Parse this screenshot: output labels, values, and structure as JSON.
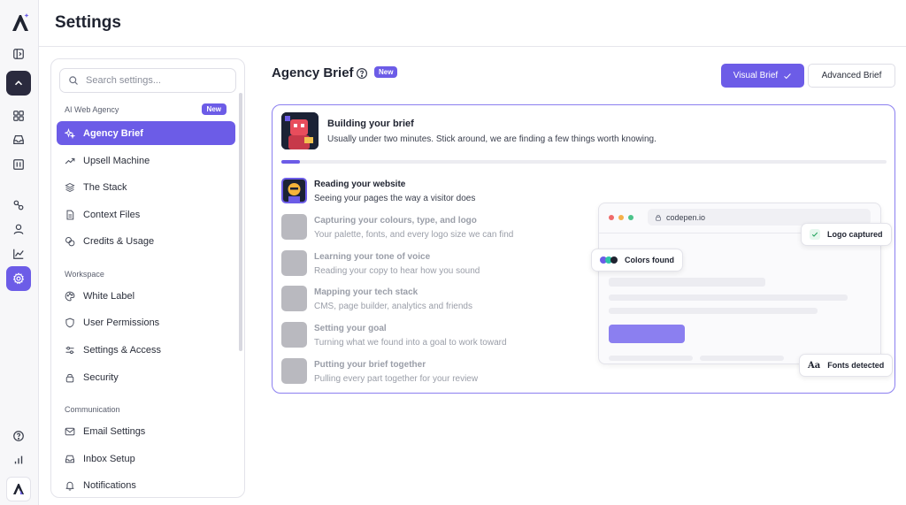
{
  "app": {
    "title": "Settings"
  },
  "rail": {
    "icons": [
      "app-logo",
      "sidebar-toggle-icon",
      "chevron-up-icon",
      "grid-icon",
      "inbox-icon",
      "calendar-icon",
      "integrations-icon",
      "user-icon",
      "chart-icon",
      "gear-icon",
      "help-icon",
      "bar-chart-icon",
      "brand-logo"
    ]
  },
  "nav": {
    "search_placeholder": "Search settings...",
    "sections": [
      {
        "label": "AI Web Agency",
        "badge": "New"
      },
      {
        "label": "Workspace"
      },
      {
        "label": "Communication"
      }
    ],
    "items": [
      {
        "label": "Agency Brief",
        "icon": "sparkle-icon",
        "active": true
      },
      {
        "label": "Upsell Machine",
        "icon": "trend-up-icon"
      },
      {
        "label": "The Stack",
        "icon": "layers-icon"
      },
      {
        "label": "Context Files",
        "icon": "file-icon"
      },
      {
        "label": "Credits & Usage",
        "icon": "coins-icon"
      },
      {
        "label": "White Label",
        "icon": "palette-icon"
      },
      {
        "label": "User Permissions",
        "icon": "shield-icon"
      },
      {
        "label": "Settings & Access",
        "icon": "sliders-icon"
      },
      {
        "label": "Security",
        "icon": "lock-icon"
      },
      {
        "label": "Email Settings",
        "icon": "mail-icon"
      },
      {
        "label": "Inbox Setup",
        "icon": "inbox-icon"
      },
      {
        "label": "Notifications",
        "icon": "bell-icon"
      }
    ]
  },
  "content": {
    "title": "Agency Brief",
    "badge": "New",
    "visual_brief_label": "Visual Brief",
    "advanced_brief_label": "Advanced Brief"
  },
  "brief": {
    "title": "Building your brief",
    "subtitle": "Usually under two minutes. Stick around, we are finding a few things worth knowing.",
    "progress": 0.03,
    "steps": [
      {
        "title": "Reading your website",
        "subtitle": "Seeing your pages the way a visitor does",
        "current": true
      },
      {
        "title": "Capturing your colours, type, and logo",
        "subtitle": "Your palette, fonts, and every logo size we can find"
      },
      {
        "title": "Learning your tone of voice",
        "subtitle": "Reading your copy to hear how you sound"
      },
      {
        "title": "Mapping your tech stack",
        "subtitle": "CMS, page builder, analytics and friends"
      },
      {
        "title": "Setting your goal",
        "subtitle": "Turning what we found into a goal to work toward"
      },
      {
        "title": "Putting your brief together",
        "subtitle": "Pulling every part together for your review"
      }
    ]
  },
  "preview": {
    "url": "codepen.io",
    "chips": {
      "colors": "Colors found",
      "logo": "Logo captured",
      "fonts_icon": "Aa",
      "fonts": "Fonts detected"
    },
    "swatches": [
      "#6c5ce7",
      "#2ec4a7",
      "#1f2330"
    ],
    "dots": [
      "#ef6a6a",
      "#f5b04a",
      "#4cc38a"
    ]
  },
  "colors": {
    "accent": "#6c5ce7",
    "border_accent": "#8b7ff0"
  }
}
